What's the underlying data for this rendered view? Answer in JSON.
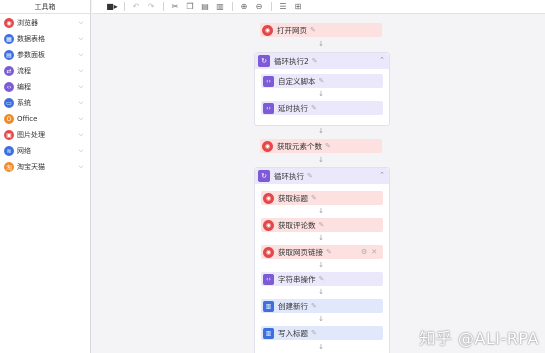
{
  "toolbox": {
    "title": "工具箱",
    "items": [
      {
        "label": "浏览器",
        "icon": "browser-icon",
        "color": "#e54848",
        "glyph": "◉"
      },
      {
        "label": "数据表格",
        "icon": "table-icon",
        "color": "#3c6fe0",
        "glyph": "▦"
      },
      {
        "label": "参数面板",
        "icon": "panel-icon",
        "color": "#3c6fe0",
        "glyph": "▤"
      },
      {
        "label": "流程",
        "icon": "flow-icon",
        "color": "#7d5bd6",
        "glyph": "⇄"
      },
      {
        "label": "编程",
        "icon": "code-icon",
        "color": "#7d5bd6",
        "glyph": "‹›"
      },
      {
        "label": "系统",
        "icon": "system-icon",
        "color": "#3c6fe0",
        "glyph": "▭"
      },
      {
        "label": "Office",
        "icon": "office-icon",
        "color": "#f08a24",
        "glyph": "O"
      },
      {
        "label": "图片处理",
        "icon": "image-icon",
        "color": "#e54848",
        "glyph": "▣"
      },
      {
        "label": "网络",
        "icon": "network-icon",
        "color": "#3c6fe0",
        "glyph": "≋"
      },
      {
        "label": "淘宝天猫",
        "icon": "taobao-icon",
        "color": "#f08a24",
        "glyph": "淘"
      }
    ]
  },
  "toolbar": {
    "record": "record-icon",
    "undo": "undo-icon",
    "redo": "redo-icon",
    "cut": "cut-icon",
    "copy": "copy-icon",
    "paste": "paste-icon",
    "delete": "delete-icon",
    "zoom_in": "zoom-in-icon",
    "zoom_out": "zoom-out-icon",
    "align": "align-icon",
    "layout": "layout-icon"
  },
  "flow": {
    "open_page": "打开网页",
    "loop1_title": "循环执行2",
    "custom_script": "自定义脚本",
    "delay": "延时执行",
    "get_count": "获取元素个数",
    "loop2_title": "循环执行",
    "get_title": "获取标题",
    "get_comments": "获取评论数",
    "get_link": "获取网页链接",
    "string_op": "字符串操作",
    "new_row": "创建新行",
    "write_title": "写入标题"
  },
  "watermark": "知乎 @ALI-RPA"
}
